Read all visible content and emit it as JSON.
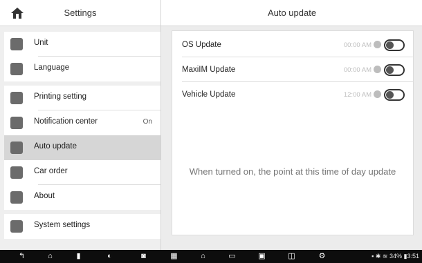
{
  "left_panel": {
    "title": "Settings",
    "items": [
      {
        "label": "Unit",
        "icon": "unit-icon",
        "value": ""
      },
      {
        "label": "Language",
        "icon": "globe-icon",
        "value": ""
      },
      {
        "label": "Printing setting",
        "icon": "printer-icon",
        "value": ""
      },
      {
        "label": "Notification center",
        "icon": "notification-icon",
        "value": "On"
      },
      {
        "label": "Auto update",
        "icon": "update-icon",
        "value": ""
      },
      {
        "label": "Car order",
        "icon": "car-order-icon",
        "value": ""
      },
      {
        "label": "About",
        "icon": "info-icon",
        "value": ""
      },
      {
        "label": "System settings",
        "icon": "system-settings-icon",
        "value": ""
      }
    ]
  },
  "right_panel": {
    "title": "Auto update",
    "rows": [
      {
        "label": "OS Update",
        "time": "00:00 AM"
      },
      {
        "label": "MaxiIM Update",
        "time": "00:00 AM"
      },
      {
        "label": "Vehicle Update",
        "time": "12:00 AM"
      }
    ],
    "hint": "When turned on, the point at this time of day update"
  },
  "status_bar": {
    "battery": "34%",
    "time": "3:51"
  }
}
